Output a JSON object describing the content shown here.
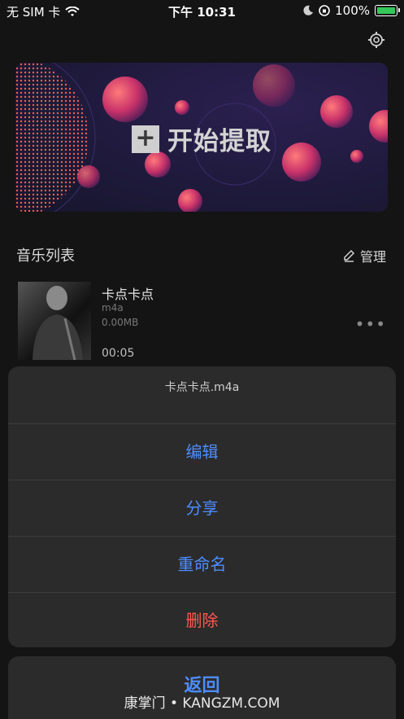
{
  "status_bar": {
    "carrier": "无 SIM 卡",
    "time": "下午 10:31",
    "battery": "100%"
  },
  "banner": {
    "cta_label": "开始提取"
  },
  "music_section": {
    "title": "音乐列表",
    "manage_label": "管理"
  },
  "music_items": [
    {
      "title": "卡点卡点",
      "format": "m4a",
      "size": "0.00MB",
      "duration": "00:05"
    }
  ],
  "action_sheet": {
    "title": "卡点卡点.m4a",
    "items": [
      "编辑",
      "分享",
      "重命名",
      "删除"
    ],
    "cancel_label": "返回"
  },
  "watermark": "康掌门 • KANGZM.COM",
  "colors": {
    "accent": "#4d8dff",
    "danger": "#ff5a4e",
    "sheet_bg": "#2b2b2b",
    "app_bg": "#141414"
  }
}
